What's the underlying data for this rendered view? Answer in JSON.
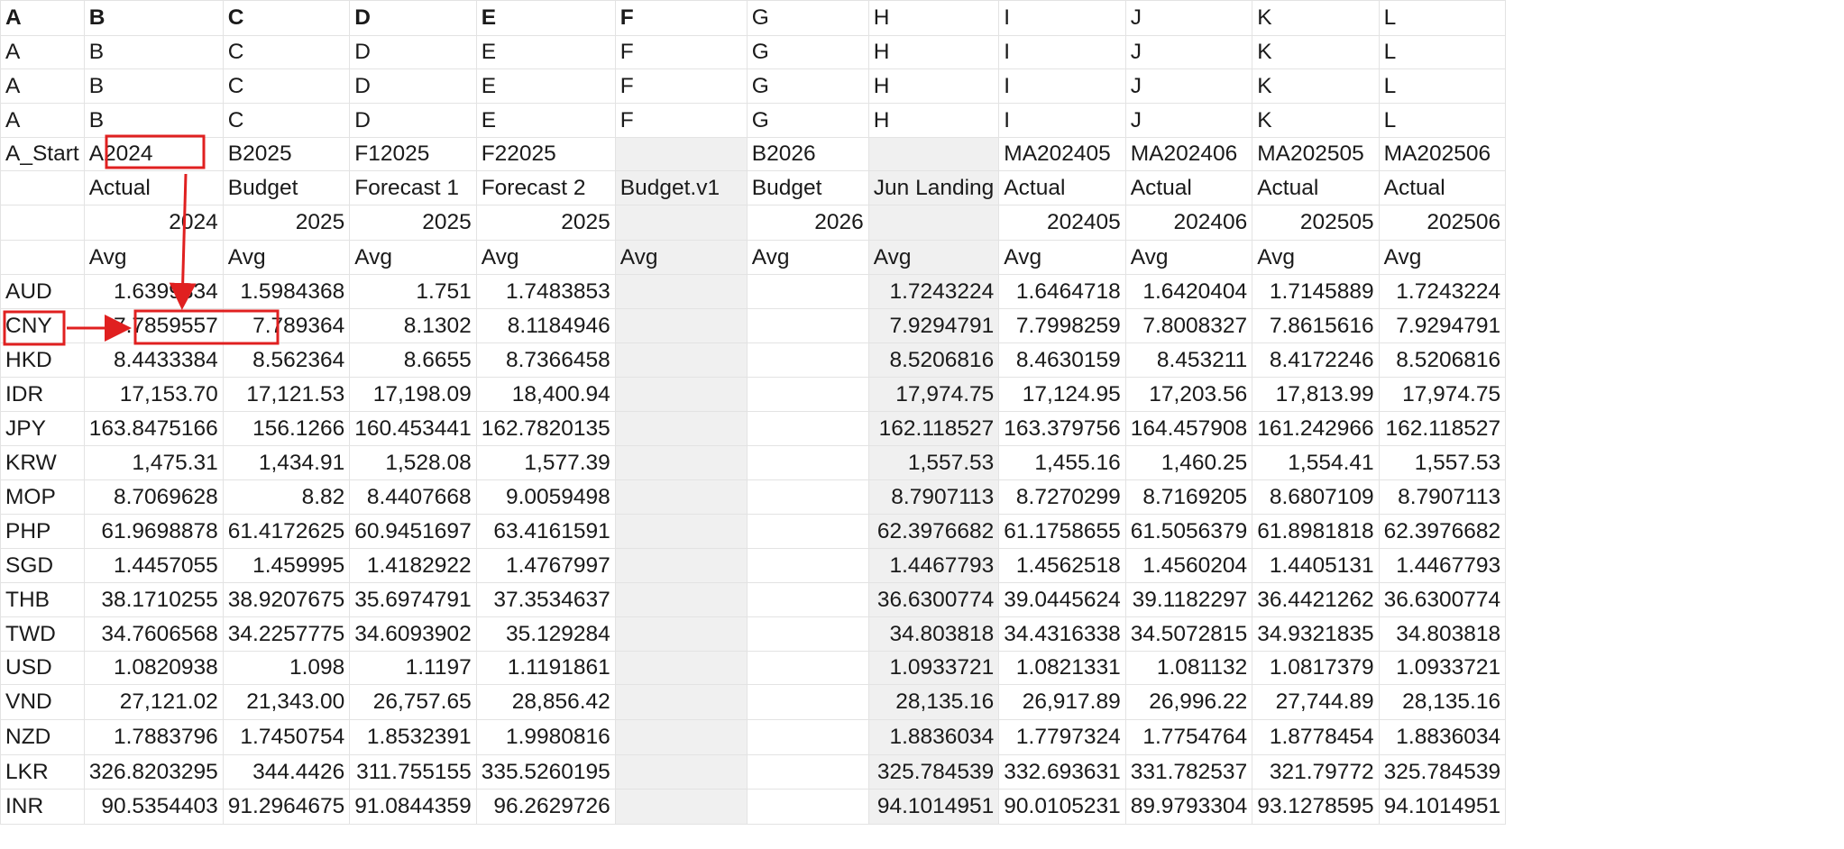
{
  "header_rows": [
    [
      "A",
      "B",
      "C",
      "D",
      "E",
      "F",
      "G",
      "H",
      "I",
      "J",
      "K",
      "L"
    ],
    [
      "A",
      "B",
      "C",
      "D",
      "E",
      "F",
      "G",
      "H",
      "I",
      "J",
      "K",
      "L"
    ],
    [
      "A",
      "B",
      "C",
      "D",
      "E",
      "F",
      "G",
      "H",
      "I",
      "J",
      "K",
      "L"
    ],
    [
      "A",
      "B",
      "C",
      "D",
      "E",
      "F",
      "G",
      "H",
      "I",
      "J",
      "K",
      "L"
    ],
    [
      "A_Start",
      "A2024",
      "B2025",
      "F12025",
      "F22025",
      "",
      "B2026",
      "",
      "MA202405",
      "MA202406",
      "MA202505",
      "MA202506"
    ],
    [
      "",
      "Actual",
      "Budget",
      "Forecast 1",
      "Forecast 2",
      "Budget.v1",
      "Budget",
      "Jun Landing",
      "Actual",
      "Actual",
      "Actual",
      "Actual"
    ],
    [
      "",
      "2024",
      "2025",
      "2025",
      "2025",
      "",
      "2026",
      "",
      "202405",
      "202406",
      "202505",
      "202506"
    ],
    [
      "",
      "Avg",
      "Avg",
      "Avg",
      "Avg",
      "Avg",
      "Avg",
      "Avg",
      "Avg",
      "Avg",
      "Avg",
      "Avg"
    ]
  ],
  "data_rows": [
    [
      "AUD",
      "1.6399334",
      "1.5984368",
      "1.751",
      "1.7483853",
      "",
      "",
      "1.7243224",
      "1.6464718",
      "1.6420404",
      "1.7145889",
      "1.7243224"
    ],
    [
      "CNY",
      "7.7859557",
      "7.789364",
      "8.1302",
      "8.1184946",
      "",
      "",
      "7.9294791",
      "7.7998259",
      "7.8008327",
      "7.8615616",
      "7.9294791"
    ],
    [
      "HKD",
      "8.4433384",
      "8.562364",
      "8.6655",
      "8.7366458",
      "",
      "",
      "8.5206816",
      "8.4630159",
      "8.453211",
      "8.4172246",
      "8.5206816"
    ],
    [
      "IDR",
      "17,153.70",
      "17,121.53",
      "17,198.09",
      "18,400.94",
      "",
      "",
      "17,974.75",
      "17,124.95",
      "17,203.56",
      "17,813.99",
      "17,974.75"
    ],
    [
      "JPY",
      "163.8475166",
      "156.1266",
      "160.453441",
      "162.7820135",
      "",
      "",
      "162.118527",
      "163.379756",
      "164.457908",
      "161.242966",
      "162.118527"
    ],
    [
      "KRW",
      "1,475.31",
      "1,434.91",
      "1,528.08",
      "1,577.39",
      "",
      "",
      "1,557.53",
      "1,455.16",
      "1,460.25",
      "1,554.41",
      "1,557.53"
    ],
    [
      "MOP",
      "8.7069628",
      "8.82",
      "8.4407668",
      "9.0059498",
      "",
      "",
      "8.7907113",
      "8.7270299",
      "8.7169205",
      "8.6807109",
      "8.7907113"
    ],
    [
      "PHP",
      "61.9698878",
      "61.4172625",
      "60.9451697",
      "63.4161591",
      "",
      "",
      "62.3976682",
      "61.1758655",
      "61.5056379",
      "61.8981818",
      "62.3976682"
    ],
    [
      "SGD",
      "1.4457055",
      "1.459995",
      "1.4182922",
      "1.4767997",
      "",
      "",
      "1.4467793",
      "1.4562518",
      "1.4560204",
      "1.4405131",
      "1.4467793"
    ],
    [
      "THB",
      "38.1710255",
      "38.9207675",
      "35.6974791",
      "37.3534637",
      "",
      "",
      "36.6300774",
      "39.0445624",
      "39.1182297",
      "36.4421262",
      "36.6300774"
    ],
    [
      "TWD",
      "34.7606568",
      "34.2257775",
      "34.6093902",
      "35.129284",
      "",
      "",
      "34.803818",
      "34.4316338",
      "34.5072815",
      "34.9321835",
      "34.803818"
    ],
    [
      "USD",
      "1.0820938",
      "1.098",
      "1.1197",
      "1.1191861",
      "",
      "",
      "1.0933721",
      "1.0821331",
      "1.081132",
      "1.0817379",
      "1.0933721"
    ],
    [
      "VND",
      "27,121.02",
      "21,343.00",
      "26,757.65",
      "28,856.42",
      "",
      "",
      "28,135.16",
      "26,917.89",
      "26,996.22",
      "27,744.89",
      "28,135.16"
    ],
    [
      "NZD",
      "1.7883796",
      "1.7450754",
      "1.8532391",
      "1.9980816",
      "",
      "",
      "1.8836034",
      "1.7797324",
      "1.7754764",
      "1.8778454",
      "1.8836034"
    ],
    [
      "LKR",
      "326.8203295",
      "344.4426",
      "311.755155",
      "335.5260195",
      "",
      "",
      "325.784539",
      "332.693631",
      "331.782537",
      "321.79772",
      "325.784539"
    ],
    [
      "INR",
      "90.5354403",
      "91.2964675",
      "91.0844359",
      "96.2629726",
      "",
      "",
      "94.1014951",
      "90.0105231",
      "89.9793304",
      "93.1278595",
      "94.1014951"
    ]
  ],
  "colors": {
    "annotation": "#e02020",
    "shaded_column": "#f0f0f0",
    "grid": "#e3e3e3"
  }
}
